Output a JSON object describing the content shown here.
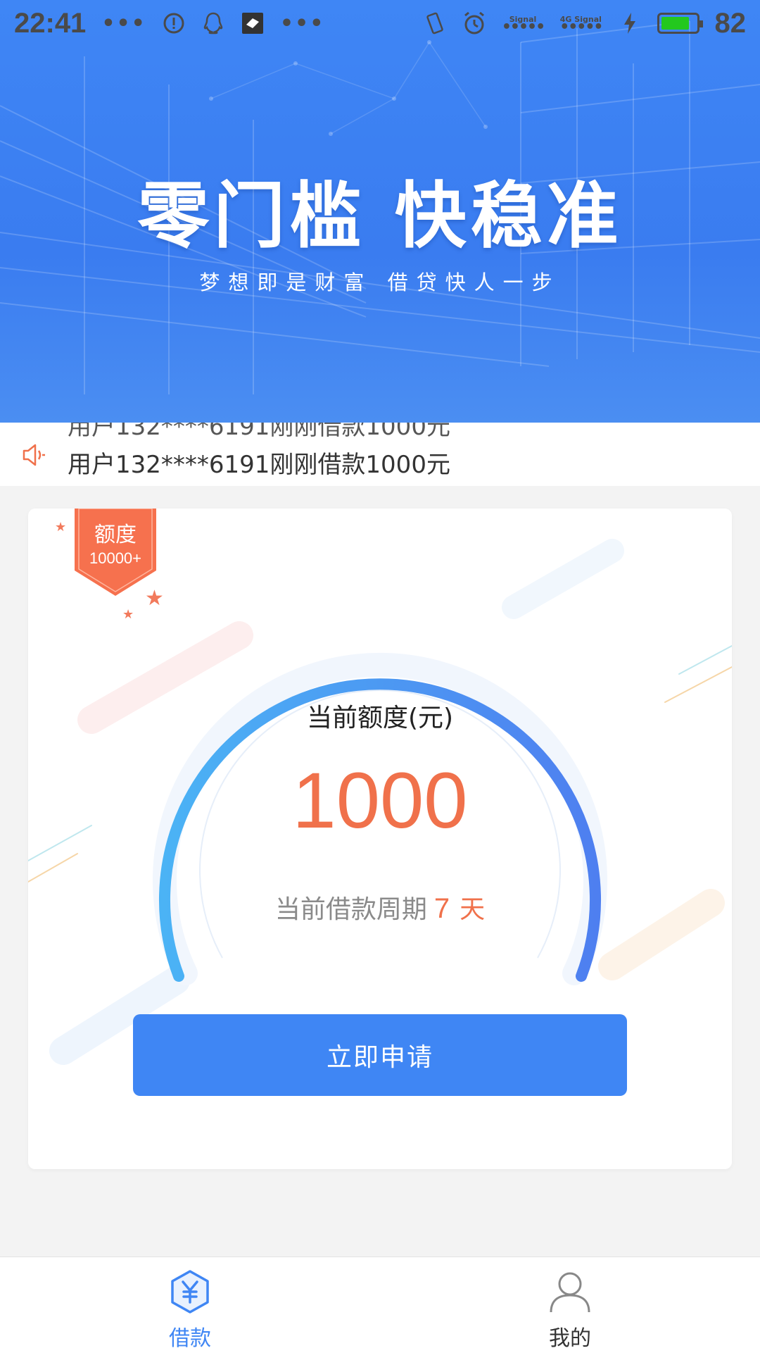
{
  "status_bar": {
    "time": "22:41",
    "dots_left": "•••",
    "dots_right": "•••",
    "signal_label_1": "Signal",
    "signal_label_2": "4G Signal",
    "battery_level": "82",
    "battery_fraction": 0.82
  },
  "banner": {
    "title": "零门槛 快稳准",
    "subtitle": "梦想即是财富 借贷快人一步"
  },
  "notice": {
    "ghost_text": "用户132****6191刚刚借款1000元",
    "text": "用户132****6191刚刚借款1000元"
  },
  "badge": {
    "title": "额度",
    "subtitle": "10000+"
  },
  "credit": {
    "label": "当前额度(元)",
    "value": "1000",
    "period_label": "当前借款周期",
    "period_value": "7",
    "period_unit": "天"
  },
  "apply_button": {
    "label": "立即申请"
  },
  "bottom_nav": {
    "items": [
      {
        "label": "借款",
        "active": true,
        "icon": "yuan-hexagon-icon"
      },
      {
        "label": "我的",
        "active": false,
        "icon": "user-icon"
      }
    ]
  },
  "colors": {
    "primary": "#3f86f4",
    "accent": "#f0714b"
  }
}
